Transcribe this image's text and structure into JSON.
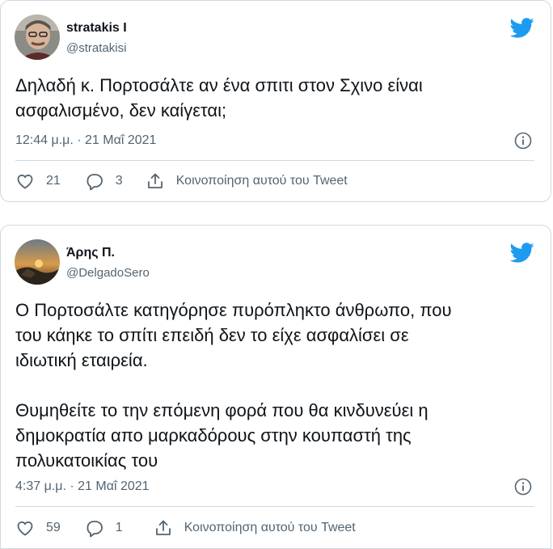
{
  "tweets": [
    {
      "author_name": "stratakis I",
      "author_handle": "@stratakisi",
      "text": "Δηλαδή κ. Πορτοσάλτε αν ένα σπιτι στον Σχινο είναι\nασφαλισμένο, δεν καίγεται;",
      "timestamp": "12:44 μ.μ. · 21 Μαΐ 2021",
      "likes": "21",
      "replies": "3",
      "share_label": "Κοινοποίηση αυτού του Tweet"
    },
    {
      "author_name": "Άρης Π.",
      "author_handle": "@DelgadoSero",
      "text": "Ο Πορτοσάλτε κατηγόρησε πυρόπληκτο άνθρωπο, που\nτου κάηκε το σπίτι επειδή δεν το είχε ασφαλίσει σε\nιδιωτική εταιρεία.\n\nΘυμηθείτε το την επόμενη φορά που θα κινδυνεύει η\nδημοκρατία απο μαρκαδόρους στην κουπαστή της\nπολυκατοικίας του",
      "timestamp": "4:37 μ.μ. · 21 Μαΐ 2021",
      "likes": "59",
      "replies": "1",
      "share_label": "Κοινοποίηση αυτού του Tweet"
    }
  ],
  "colors": {
    "twitter_blue": "#1d9bf0",
    "secondary_text": "#536471",
    "border": "#cfd9de"
  },
  "icons": [
    "twitter-bird-icon",
    "info-icon",
    "heart-icon",
    "reply-icon",
    "share-icon"
  ]
}
